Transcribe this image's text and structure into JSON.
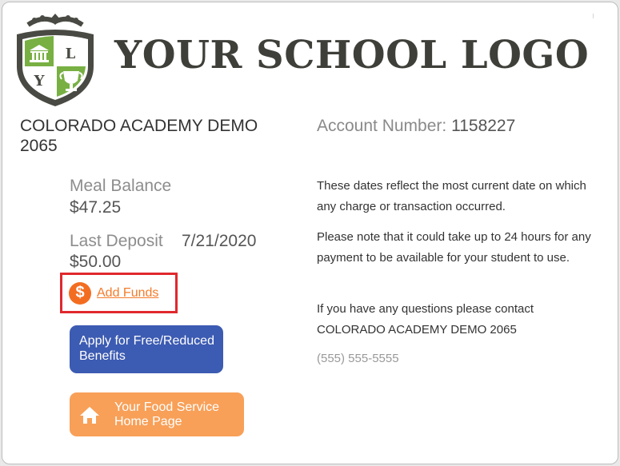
{
  "logo": {
    "text": "YOUR SCHOOL LOGO",
    "crest_letters": [
      "L",
      "Y"
    ],
    "crest_icons": [
      "school-building-icon",
      "trophy-icon"
    ],
    "colors": {
      "green": "#78b043",
      "dark": "#4a4a44"
    }
  },
  "school": {
    "name": "COLORADO ACADEMY DEMO 2065"
  },
  "account": {
    "label": "Account Number:",
    "number": "1158227"
  },
  "balance": {
    "meal_label": "Meal Balance",
    "meal_value": "$47.25",
    "last_deposit_label": "Last Deposit",
    "last_deposit_date": "7/21/2020",
    "last_deposit_value": "$50.00"
  },
  "actions": {
    "add_funds_icon_text": "$",
    "add_funds_label": "Add Funds",
    "apply_label": "Apply for Free/Reduced Benefits",
    "home_label": "Your Food Service Home Page"
  },
  "info": {
    "para1": "These dates reflect the most current date on which any charge or transaction occurred.",
    "para2": "Please note that it could take up to 24 hours for any payment to be available for your student to use.",
    "para3": "If you have any questions please contact COLORADO ACADEMY DEMO 2065",
    "phone": "(555) 555-5555"
  },
  "colors": {
    "accent_orange": "#f36d21",
    "apply_blue": "#3c5bb2",
    "home_orange": "#f8a058",
    "highlight_red": "#e0282d"
  }
}
